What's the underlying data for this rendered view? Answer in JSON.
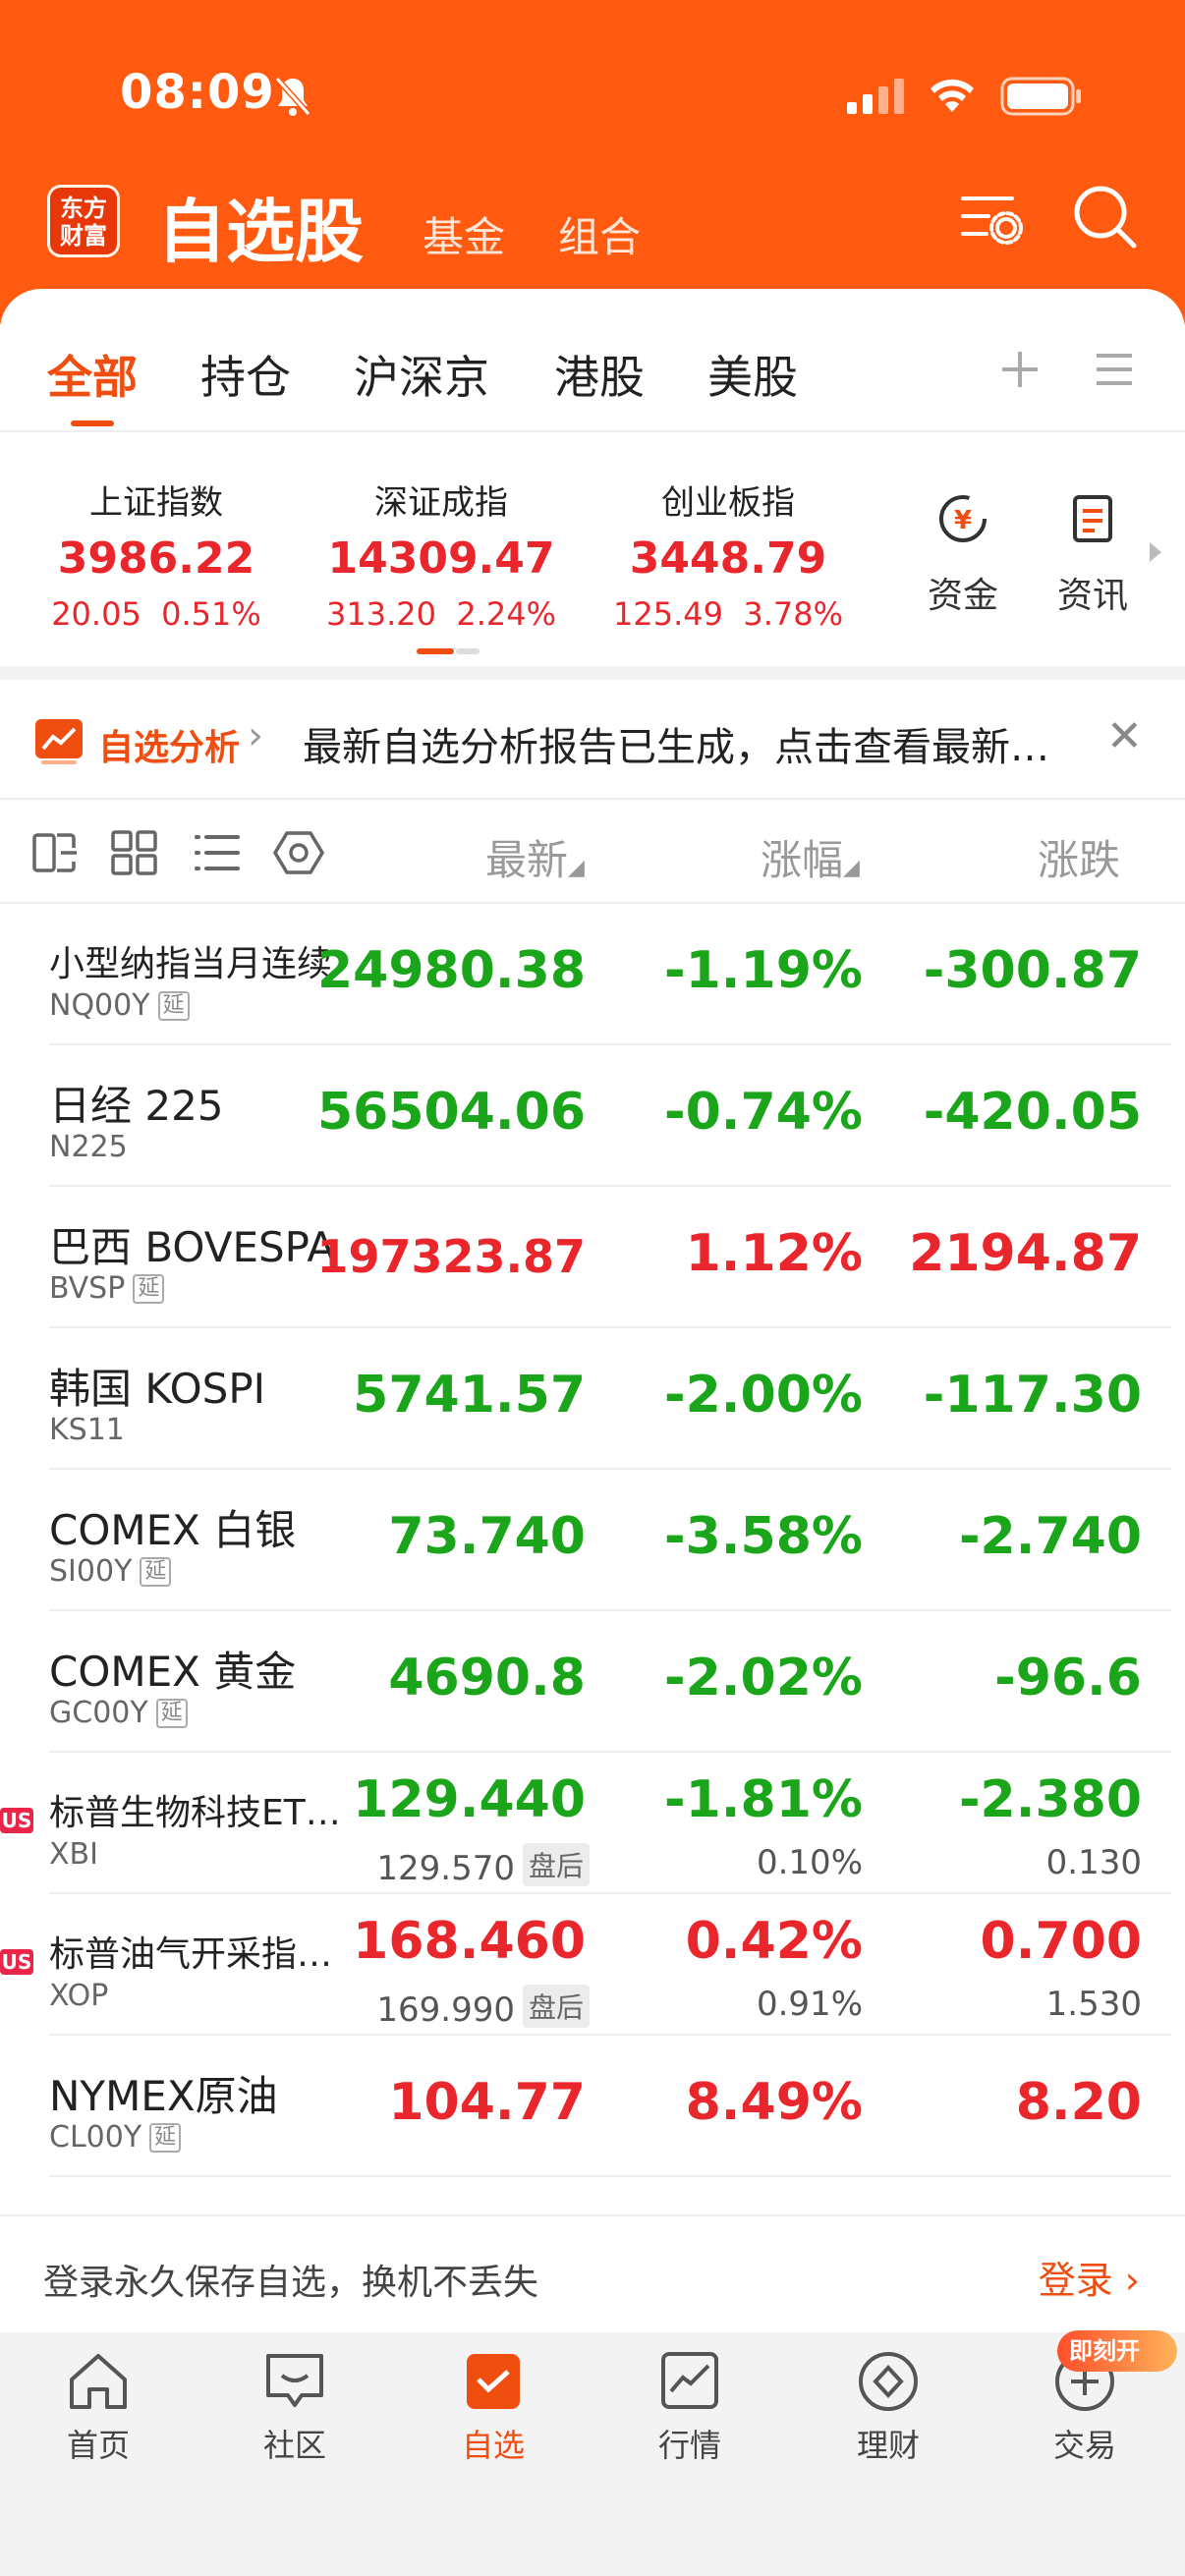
{
  "status_bar": {
    "time": "08:09"
  },
  "header": {
    "logo_text_line1": "东方",
    "logo_text_line2": "财富",
    "title": "自选股",
    "tabs": [
      "基金",
      "组合"
    ]
  },
  "main_tabs": [
    "全部",
    "持仓",
    "沪深京",
    "港股",
    "美股"
  ],
  "indices": [
    {
      "name": "上证指数",
      "value": "3986.22",
      "change": "20.05",
      "pct": "0.51%"
    },
    {
      "name": "深证成指",
      "value": "14309.47",
      "change": "313.20",
      "pct": "2.24%"
    },
    {
      "name": "创业板指",
      "value": "3448.79",
      "change": "125.49",
      "pct": "3.78%"
    }
  ],
  "quick_buttons": [
    {
      "label": "资金",
      "icon": "yuan-circle-icon"
    },
    {
      "label": "资讯",
      "icon": "document-icon"
    }
  ],
  "banner": {
    "title": "自选分析",
    "text": "最新自选分析报告已生成，点击查看最新…"
  },
  "columns": {
    "latest": "最新",
    "pct": "涨幅",
    "change": "涨跌"
  },
  "rows": [
    {
      "name": "小型纳指当月连续",
      "code": "NQ00Y",
      "delayed": "延",
      "price": "24980.38",
      "pct": "-1.19%",
      "change": "-300.87"
    },
    {
      "name": "日经 225",
      "code": "N225",
      "price": "56504.06",
      "pct": "-0.74%",
      "change": "-420.05"
    },
    {
      "name": "巴西 BOVESPA",
      "code": "BVSP",
      "delayed": "延",
      "price": "197323.87",
      "pct": "1.12%",
      "change": "2194.87"
    },
    {
      "name": "韩国 KOSPI",
      "code": "KS11",
      "price": "5741.57",
      "pct": "-2.00%",
      "change": "-117.30"
    },
    {
      "name": "COMEX 白银",
      "code": "SI00Y",
      "delayed": "延",
      "price": "73.740",
      "pct": "-3.58%",
      "change": "-2.740"
    },
    {
      "name": "COMEX 黄金",
      "code": "GC00Y",
      "delayed": "延",
      "price": "4690.8",
      "pct": "-2.02%",
      "change": "-96.6"
    },
    {
      "name": "标普生物科技ET…",
      "code": "XBI",
      "market": "US",
      "price": "129.440",
      "pct": "-1.81%",
      "change": "-2.380",
      "after_price": "129.570",
      "after_label": "盘后",
      "after_pct": "0.10%",
      "after_change": "0.130"
    },
    {
      "name": "标普油气开采指…",
      "code": "XOP",
      "market": "US",
      "price": "168.460",
      "pct": "0.42%",
      "change": "0.700",
      "after_price": "169.990",
      "after_label": "盘后",
      "after_pct": "0.91%",
      "after_change": "1.530"
    },
    {
      "name": "NYMEX原油",
      "code": "CL00Y",
      "delayed": "延",
      "price": "104.77",
      "pct": "8.49%",
      "change": "8.20"
    }
  ],
  "login": {
    "text": "登录永久保存自选，换机不丢失",
    "button": "登录"
  },
  "tabbar": {
    "items": [
      "首页",
      "社区",
      "自选",
      "行情",
      "理财",
      "交易"
    ],
    "badge": "即刻开"
  },
  "colors": {
    "brand": "#ff5a0f",
    "up": "#e9262b",
    "down": "#1aa51a"
  }
}
